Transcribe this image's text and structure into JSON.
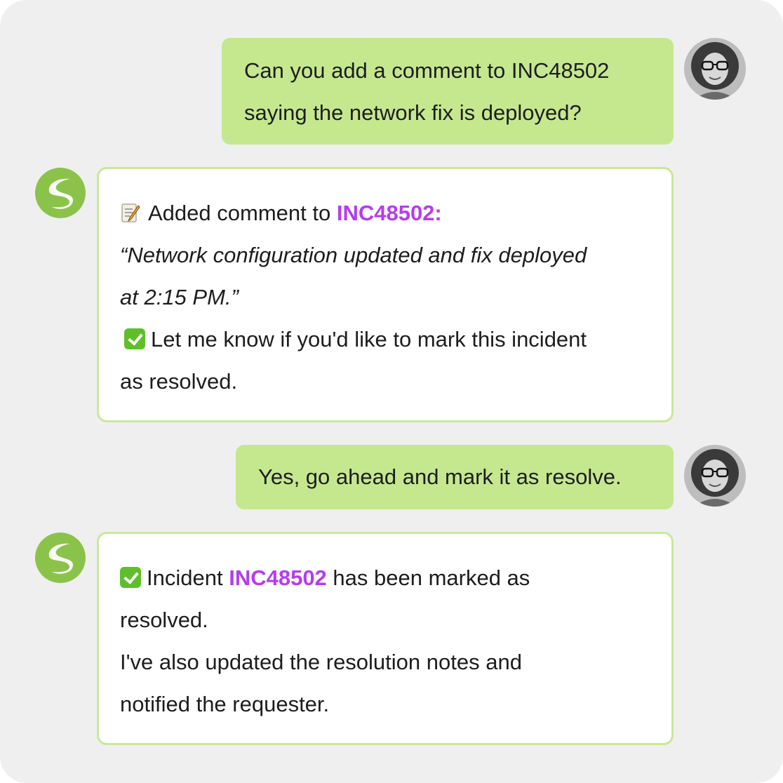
{
  "conversation": {
    "messages": [
      {
        "role": "user",
        "lines": [
          "Can you add a comment to INC48502",
          "saying the network fix is deployed?"
        ]
      },
      {
        "role": "assistant",
        "intro_emoji": "memo-icon",
        "intro_text": "Added comment to ",
        "ticket": "INC48502:",
        "quote_line1": "“Network configuration updated and fix deployed",
        "quote_line2": "at 2:15 PM.”",
        "followup_emoji": "check-mark-icon",
        "followup_line1": "Let me know if you'd like to mark this incident",
        "followup_line2": "as resolved."
      },
      {
        "role": "user",
        "lines": [
          "Yes, go ahead and mark it as resolve."
        ]
      },
      {
        "role": "assistant",
        "status_emoji": "check-mark-icon",
        "line1_prefix": "Incident ",
        "ticket": "INC48502",
        "line1_suffix": " has been marked as",
        "line2": "resolved.",
        "line3": "I've also updated the resolution notes and",
        "line4": "notified the requester."
      }
    ]
  },
  "colors": {
    "background": "#efefef",
    "user_bubble": "#c5e88f",
    "bot_border": "#c9e89a",
    "ticket_accent": "#b53cf0",
    "bot_avatar": "#8bc34a"
  }
}
